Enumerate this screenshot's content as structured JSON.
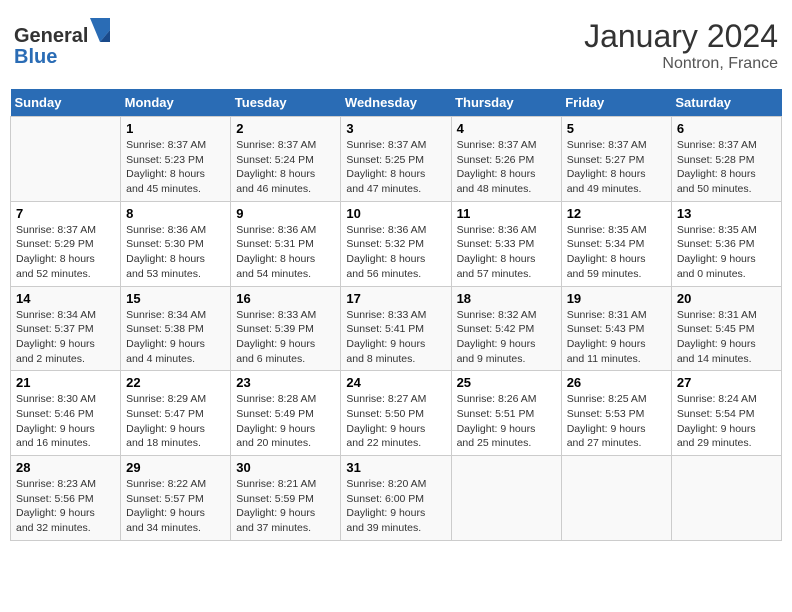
{
  "header": {
    "logo_general": "General",
    "logo_blue": "Blue",
    "month_year": "January 2024",
    "location": "Nontron, France"
  },
  "columns": [
    "Sunday",
    "Monday",
    "Tuesday",
    "Wednesday",
    "Thursday",
    "Friday",
    "Saturday"
  ],
  "weeks": [
    [
      {
        "day": "",
        "info": ""
      },
      {
        "day": "1",
        "info": "Sunrise: 8:37 AM\nSunset: 5:23 PM\nDaylight: 8 hours\nand 45 minutes."
      },
      {
        "day": "2",
        "info": "Sunrise: 8:37 AM\nSunset: 5:24 PM\nDaylight: 8 hours\nand 46 minutes."
      },
      {
        "day": "3",
        "info": "Sunrise: 8:37 AM\nSunset: 5:25 PM\nDaylight: 8 hours\nand 47 minutes."
      },
      {
        "day": "4",
        "info": "Sunrise: 8:37 AM\nSunset: 5:26 PM\nDaylight: 8 hours\nand 48 minutes."
      },
      {
        "day": "5",
        "info": "Sunrise: 8:37 AM\nSunset: 5:27 PM\nDaylight: 8 hours\nand 49 minutes."
      },
      {
        "day": "6",
        "info": "Sunrise: 8:37 AM\nSunset: 5:28 PM\nDaylight: 8 hours\nand 50 minutes."
      }
    ],
    [
      {
        "day": "7",
        "info": "Sunrise: 8:37 AM\nSunset: 5:29 PM\nDaylight: 8 hours\nand 52 minutes."
      },
      {
        "day": "8",
        "info": "Sunrise: 8:36 AM\nSunset: 5:30 PM\nDaylight: 8 hours\nand 53 minutes."
      },
      {
        "day": "9",
        "info": "Sunrise: 8:36 AM\nSunset: 5:31 PM\nDaylight: 8 hours\nand 54 minutes."
      },
      {
        "day": "10",
        "info": "Sunrise: 8:36 AM\nSunset: 5:32 PM\nDaylight: 8 hours\nand 56 minutes."
      },
      {
        "day": "11",
        "info": "Sunrise: 8:36 AM\nSunset: 5:33 PM\nDaylight: 8 hours\nand 57 minutes."
      },
      {
        "day": "12",
        "info": "Sunrise: 8:35 AM\nSunset: 5:34 PM\nDaylight: 8 hours\nand 59 minutes."
      },
      {
        "day": "13",
        "info": "Sunrise: 8:35 AM\nSunset: 5:36 PM\nDaylight: 9 hours\nand 0 minutes."
      }
    ],
    [
      {
        "day": "14",
        "info": "Sunrise: 8:34 AM\nSunset: 5:37 PM\nDaylight: 9 hours\nand 2 minutes."
      },
      {
        "day": "15",
        "info": "Sunrise: 8:34 AM\nSunset: 5:38 PM\nDaylight: 9 hours\nand 4 minutes."
      },
      {
        "day": "16",
        "info": "Sunrise: 8:33 AM\nSunset: 5:39 PM\nDaylight: 9 hours\nand 6 minutes."
      },
      {
        "day": "17",
        "info": "Sunrise: 8:33 AM\nSunset: 5:41 PM\nDaylight: 9 hours\nand 8 minutes."
      },
      {
        "day": "18",
        "info": "Sunrise: 8:32 AM\nSunset: 5:42 PM\nDaylight: 9 hours\nand 9 minutes."
      },
      {
        "day": "19",
        "info": "Sunrise: 8:31 AM\nSunset: 5:43 PM\nDaylight: 9 hours\nand 11 minutes."
      },
      {
        "day": "20",
        "info": "Sunrise: 8:31 AM\nSunset: 5:45 PM\nDaylight: 9 hours\nand 14 minutes."
      }
    ],
    [
      {
        "day": "21",
        "info": "Sunrise: 8:30 AM\nSunset: 5:46 PM\nDaylight: 9 hours\nand 16 minutes."
      },
      {
        "day": "22",
        "info": "Sunrise: 8:29 AM\nSunset: 5:47 PM\nDaylight: 9 hours\nand 18 minutes."
      },
      {
        "day": "23",
        "info": "Sunrise: 8:28 AM\nSunset: 5:49 PM\nDaylight: 9 hours\nand 20 minutes."
      },
      {
        "day": "24",
        "info": "Sunrise: 8:27 AM\nSunset: 5:50 PM\nDaylight: 9 hours\nand 22 minutes."
      },
      {
        "day": "25",
        "info": "Sunrise: 8:26 AM\nSunset: 5:51 PM\nDaylight: 9 hours\nand 25 minutes."
      },
      {
        "day": "26",
        "info": "Sunrise: 8:25 AM\nSunset: 5:53 PM\nDaylight: 9 hours\nand 27 minutes."
      },
      {
        "day": "27",
        "info": "Sunrise: 8:24 AM\nSunset: 5:54 PM\nDaylight: 9 hours\nand 29 minutes."
      }
    ],
    [
      {
        "day": "28",
        "info": "Sunrise: 8:23 AM\nSunset: 5:56 PM\nDaylight: 9 hours\nand 32 minutes."
      },
      {
        "day": "29",
        "info": "Sunrise: 8:22 AM\nSunset: 5:57 PM\nDaylight: 9 hours\nand 34 minutes."
      },
      {
        "day": "30",
        "info": "Sunrise: 8:21 AM\nSunset: 5:59 PM\nDaylight: 9 hours\nand 37 minutes."
      },
      {
        "day": "31",
        "info": "Sunrise: 8:20 AM\nSunset: 6:00 PM\nDaylight: 9 hours\nand 39 minutes."
      },
      {
        "day": "",
        "info": ""
      },
      {
        "day": "",
        "info": ""
      },
      {
        "day": "",
        "info": ""
      }
    ]
  ]
}
